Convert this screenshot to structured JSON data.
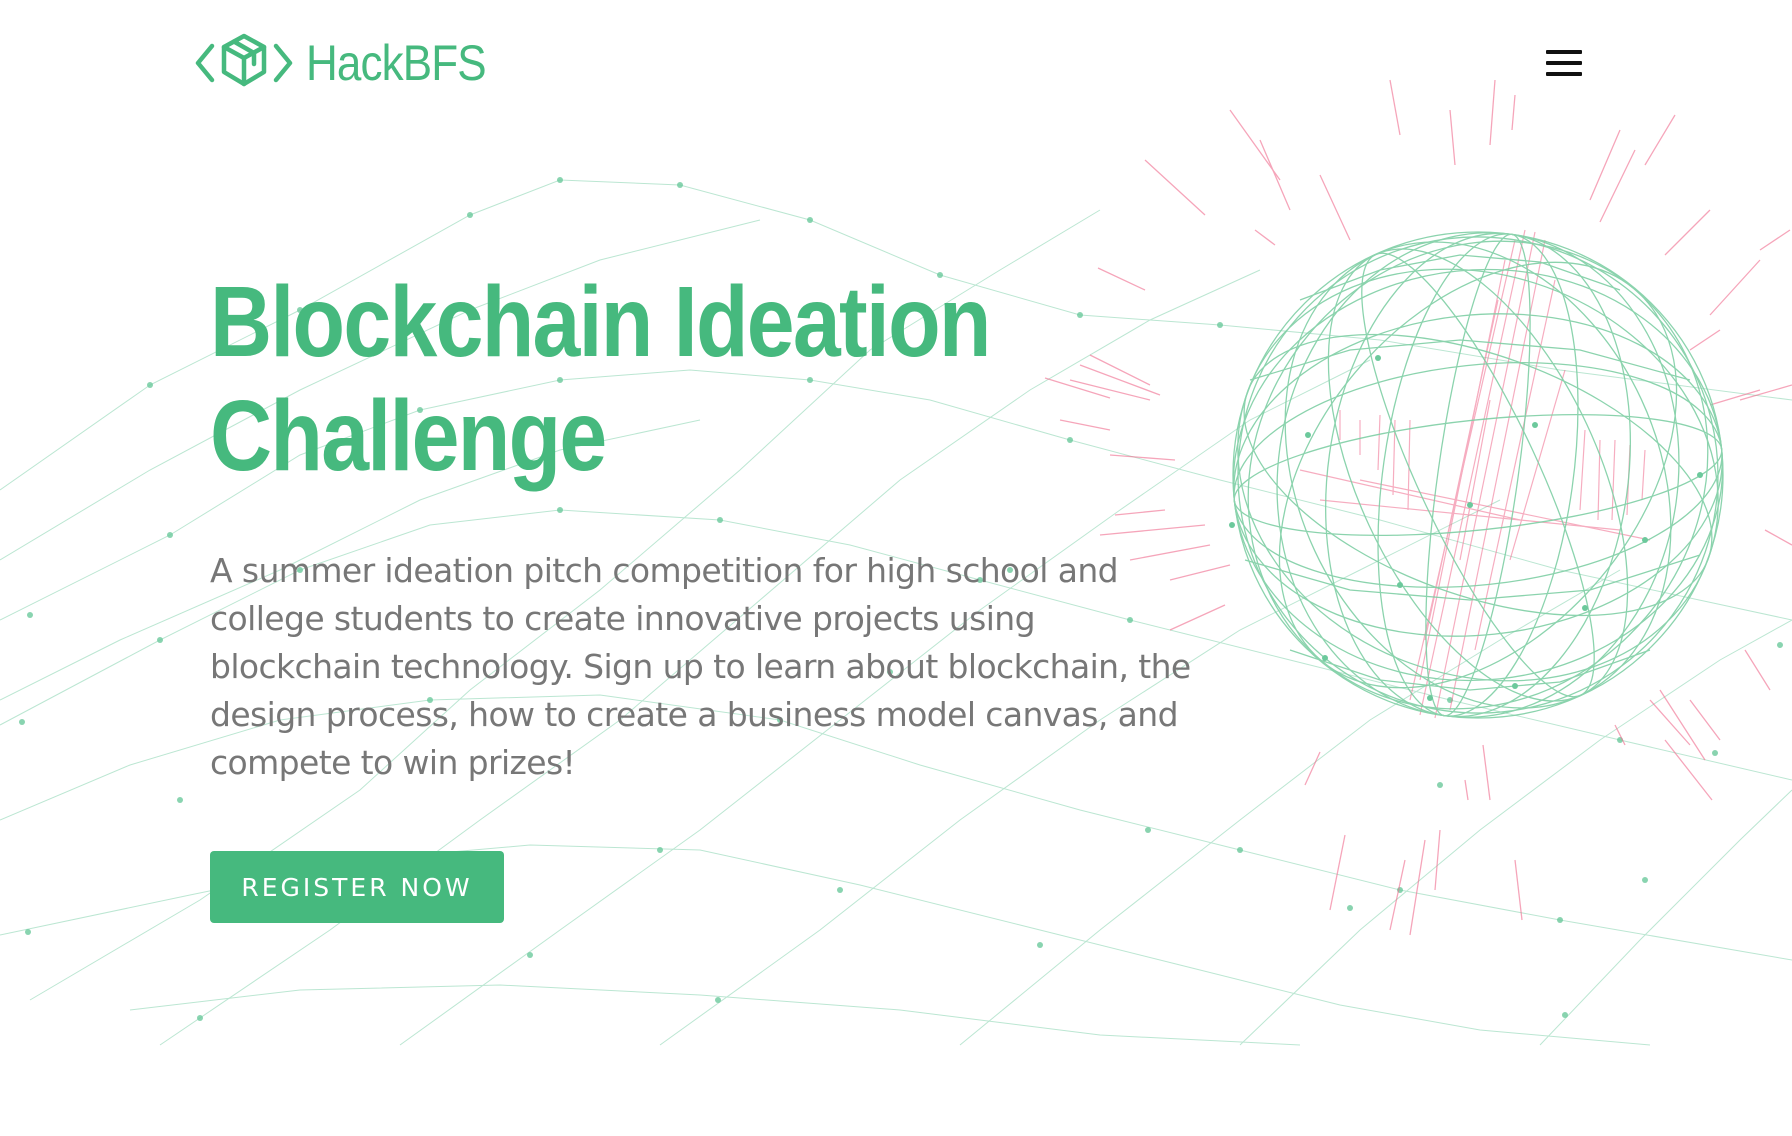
{
  "header": {
    "brand_name": "HackBFS",
    "logo_icon": "cube-code-brackets-icon",
    "menu_icon": "hamburger-menu-icon"
  },
  "hero": {
    "title_line1": "Blockchain Ideation",
    "title_line2": "Challenge",
    "description": "A summer ideation pitch competition for high school and college students to create innovative projects using blockchain technology. Sign up to learn about blockchain, the design process, how to create a business model canvas, and compete to win prizes!",
    "cta_label": "REGISTER NOW"
  },
  "colors": {
    "accent": "#46b97e",
    "text_body": "#777777",
    "pink_lines": "#f06b8d",
    "mesh": "#9ad9bb",
    "background": "#ffffff"
  }
}
